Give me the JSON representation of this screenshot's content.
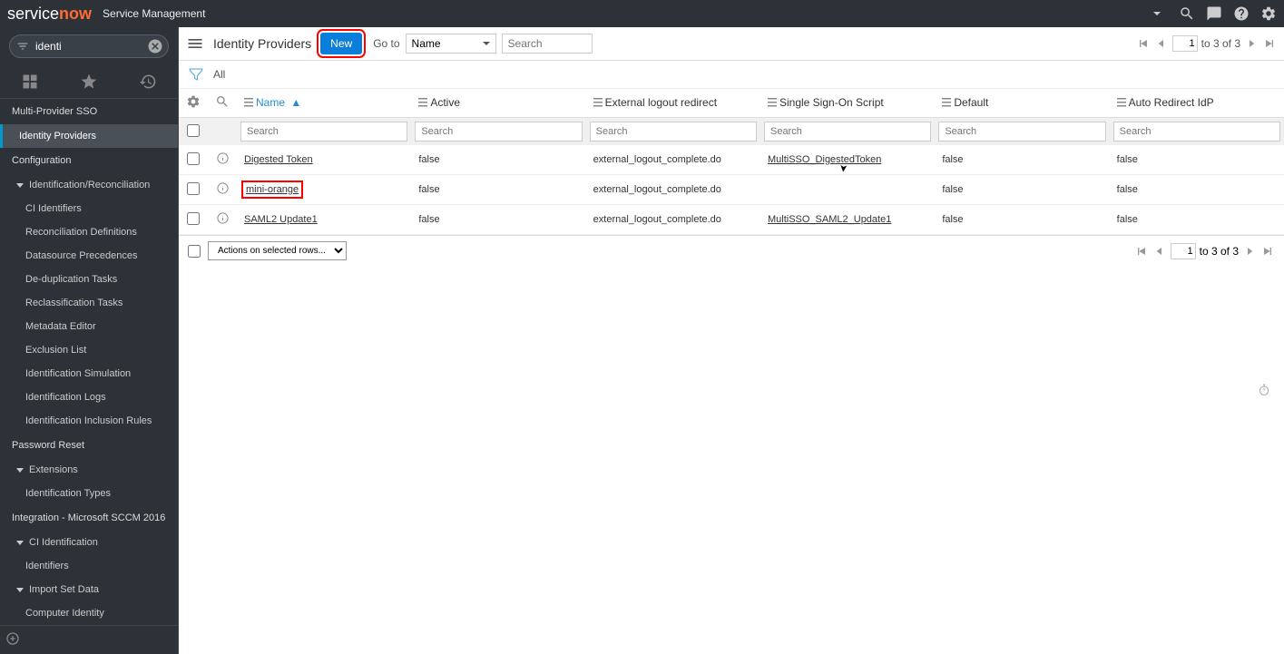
{
  "header": {
    "logo_text": "service",
    "logo_now": "now",
    "app_label": "Service Management"
  },
  "sidebar": {
    "filter_value": "identi",
    "sections": [
      {
        "type": "section",
        "label": "Multi-Provider SSO"
      },
      {
        "type": "item",
        "label": "Identity Providers",
        "active": true
      },
      {
        "type": "section",
        "label": "Configuration"
      },
      {
        "type": "group",
        "label": "Identification/Reconciliation"
      },
      {
        "type": "sub",
        "label": "CI Identifiers"
      },
      {
        "type": "sub",
        "label": "Reconciliation Definitions"
      },
      {
        "type": "sub",
        "label": "Datasource Precedences"
      },
      {
        "type": "sub",
        "label": "De-duplication Tasks"
      },
      {
        "type": "sub",
        "label": "Reclassification Tasks"
      },
      {
        "type": "sub",
        "label": "Metadata Editor"
      },
      {
        "type": "sub",
        "label": "Exclusion List"
      },
      {
        "type": "sub",
        "label": "Identification Simulation"
      },
      {
        "type": "sub",
        "label": "Identification Logs"
      },
      {
        "type": "sub",
        "label": "Identification Inclusion Rules"
      },
      {
        "type": "section",
        "label": "Password Reset"
      },
      {
        "type": "group",
        "label": "Extensions"
      },
      {
        "type": "sub",
        "label": "Identification Types"
      },
      {
        "type": "section",
        "label": "Integration - Microsoft SCCM 2016"
      },
      {
        "type": "group",
        "label": "CI Identification"
      },
      {
        "type": "sub",
        "label": "Identifiers"
      },
      {
        "type": "group",
        "label": "Import Set Data"
      },
      {
        "type": "sub",
        "label": "Computer Identity"
      }
    ]
  },
  "list": {
    "title": "Identity Providers",
    "new_btn": "New",
    "goto_label": "Go to",
    "goto_field": "Name",
    "search_placeholder": "Search",
    "filter_all": "All",
    "pager": {
      "current": "1",
      "text": "to 3 of 3"
    },
    "columns": [
      {
        "label": "Name",
        "sorted": true
      },
      {
        "label": "Active"
      },
      {
        "label": "External logout redirect"
      },
      {
        "label": "Single Sign-On Script"
      },
      {
        "label": "Default"
      },
      {
        "label": "Auto Redirect IdP"
      }
    ],
    "col_search_placeholder": "Search",
    "rows": [
      {
        "name": "Digested Token",
        "active": "false",
        "external": "external_logout_complete.do",
        "sso": "MultiSSO_DigestedToken",
        "default": "false",
        "auto": "false",
        "hl": false
      },
      {
        "name": "mini-orange",
        "active": "false",
        "external": "external_logout_complete.do",
        "sso": "",
        "default": "false",
        "auto": "false",
        "hl": true
      },
      {
        "name": "SAML2 Update1",
        "active": "false",
        "external": "external_logout_complete.do",
        "sso": "MultiSSO_SAML2_Update1",
        "default": "false",
        "auto": "false",
        "hl": false
      }
    ],
    "actions_label": "Actions on selected rows...",
    "footer_pager": {
      "current": "1",
      "text": "to 3 of 3"
    }
  }
}
